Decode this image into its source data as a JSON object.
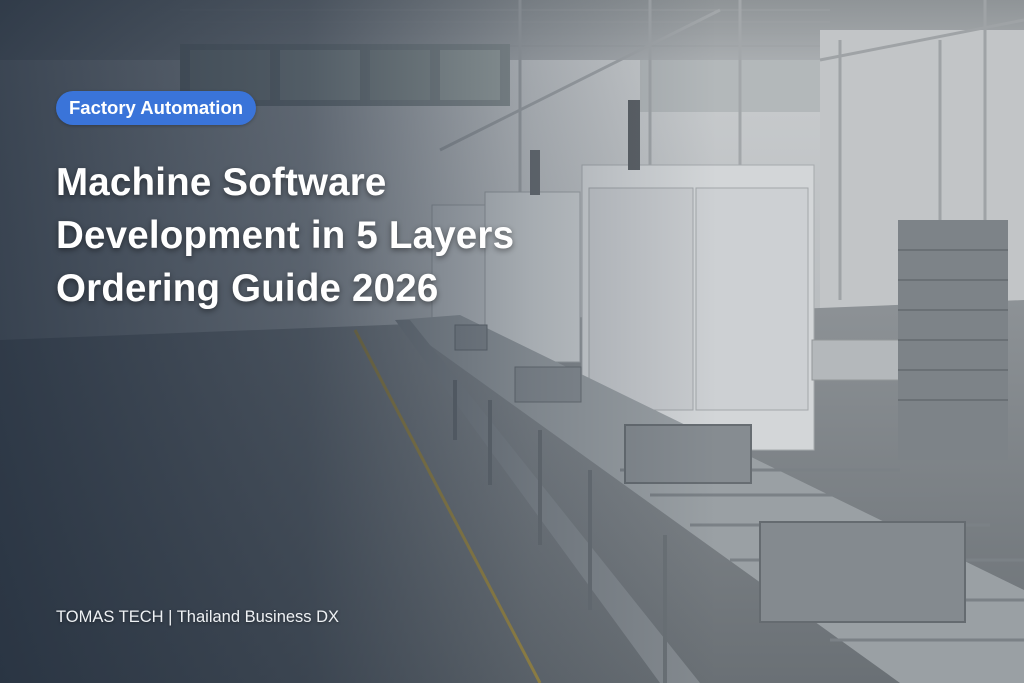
{
  "badge": {
    "label": "Factory Automation",
    "color": "#3a74d9"
  },
  "title": {
    "line1": "Machine Software",
    "line2": "Development in 5 Layers",
    "line3": "Ordering Guide 2026"
  },
  "footer": {
    "text": "TOMAS TECH | Thailand Business DX"
  },
  "image": {
    "subject": "factory-conveyor-line-photo"
  }
}
